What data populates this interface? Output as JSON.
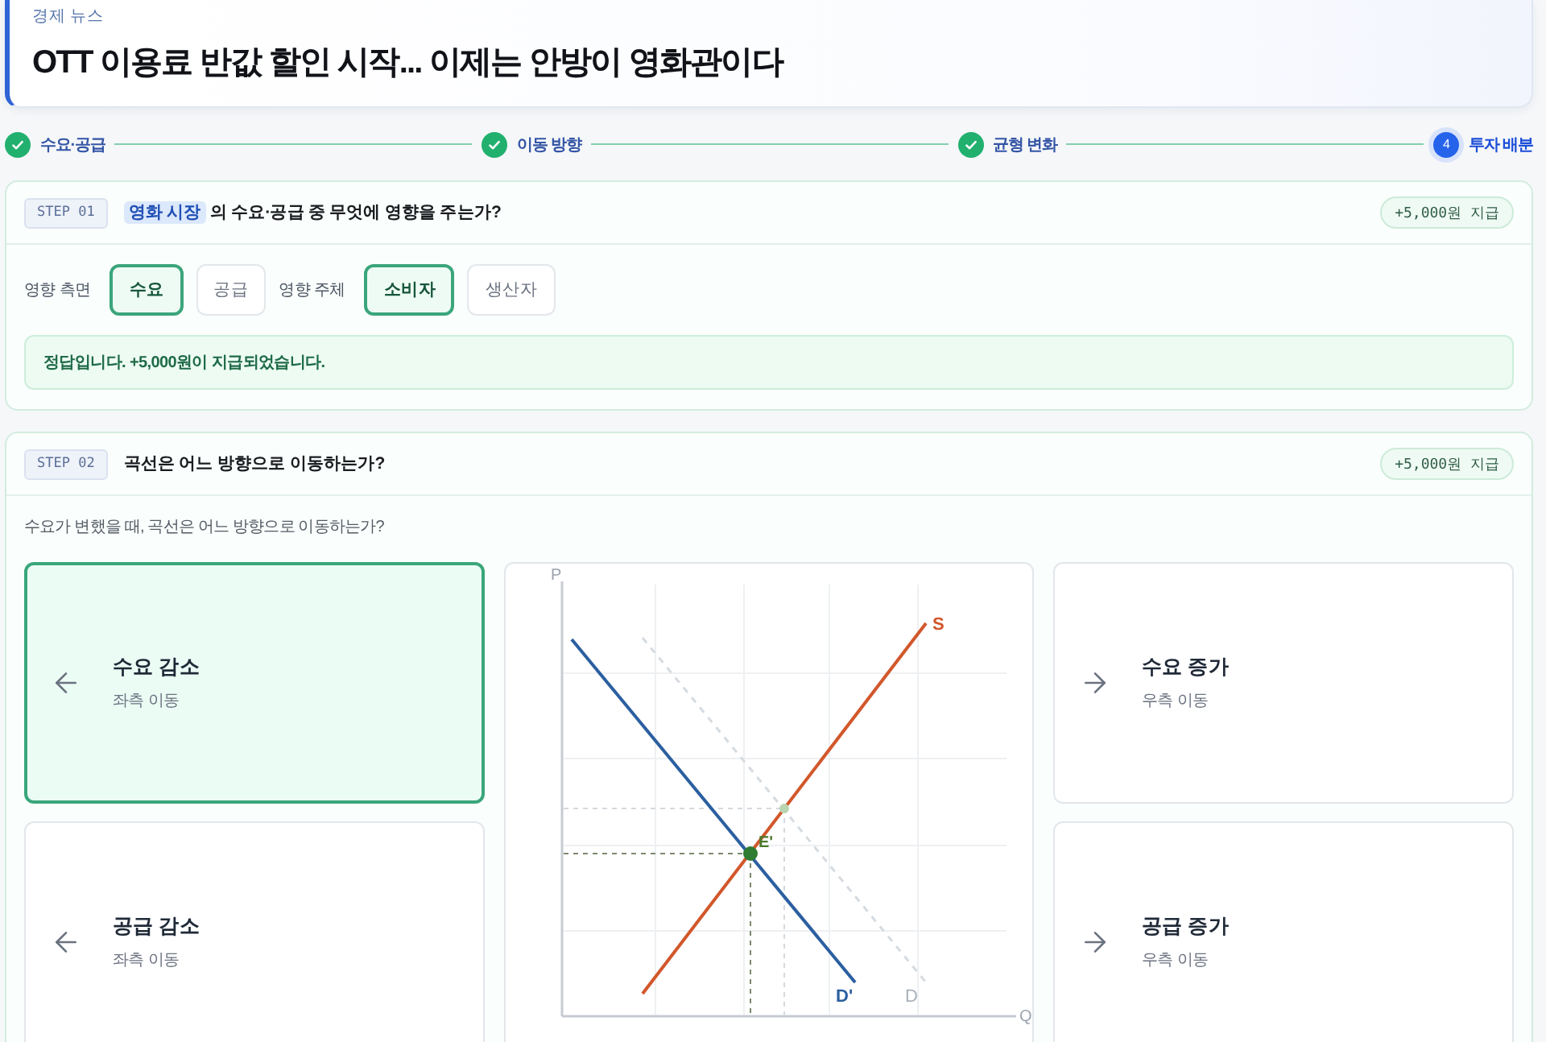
{
  "header": {
    "category": "경제 뉴스",
    "title": "OTT 이용료 반값 할인 시작... 이제는 안방이 영화관이다"
  },
  "progress_steps": [
    {
      "label": "수요·공급",
      "completed": true,
      "current": false
    },
    {
      "label": "이동 방향",
      "completed": true,
      "current": false
    },
    {
      "label": "균형 변화",
      "completed": true,
      "current": false
    },
    {
      "label": "투자 배분",
      "number": "4",
      "completed": false,
      "current": true
    }
  ],
  "steps": [
    {
      "kind": "options",
      "badge": "STEP 01",
      "question": {
        "highlight": "영화 시장",
        "text": "의 수요·공급 중 무엇에 영향을 주는가?"
      },
      "reward": "+5,000원 지급",
      "option_groups": [
        {
          "label": "영향 측면",
          "options": [
            {
              "label": "수요",
              "selected": true
            },
            {
              "label": "공급",
              "selected": false
            }
          ]
        },
        {
          "label": "영향 주체",
          "options": [
            {
              "label": "소비자",
              "selected": true
            },
            {
              "label": "생산자",
              "selected": false
            }
          ]
        }
      ],
      "feedback": "정답입니다. +5,000원이 지급되었습니다."
    },
    {
      "kind": "graph",
      "badge": "STEP 02",
      "question": {
        "text": "곡선은 어느 방향으로 이동하는가?"
      },
      "reward": "+5,000원 지급",
      "prompt": "수요가 변했을 때, 곡선은 어느 방향으로 이동하는가?",
      "choices": [
        {
          "kind": "left",
          "title": "수요 감소",
          "subtitle": "좌측 이동",
          "selected": true
        },
        {
          "kind": "left",
          "title": "공급 감소",
          "subtitle": "좌측 이동",
          "selected": false
        },
        {
          "kind": "right",
          "title": "수요 증가",
          "subtitle": "우측 이동",
          "selected": false
        },
        {
          "kind": "right",
          "title": "공급 증가",
          "subtitle": "우측 이동",
          "selected": false
        }
      ],
      "graph": {
        "y_axis": "P",
        "x_axis": "Q",
        "supply_label": "S",
        "shifted_demand_label": "D'",
        "original_demand_label": "D",
        "equilibrium_label": "E'"
      }
    }
  ]
}
